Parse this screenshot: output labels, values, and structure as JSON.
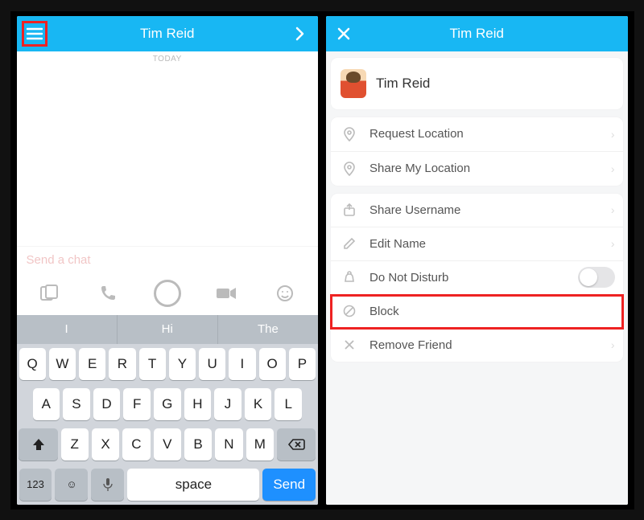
{
  "left": {
    "title": "Tim Reid",
    "meta": "TODAY",
    "placeholder": "Send a chat",
    "suggestions": [
      "I",
      "Hi",
      "The"
    ],
    "keys_r1": [
      "Q",
      "W",
      "E",
      "R",
      "T",
      "Y",
      "U",
      "I",
      "O",
      "P"
    ],
    "keys_r2": [
      "A",
      "S",
      "D",
      "F",
      "G",
      "H",
      "J",
      "K",
      "L"
    ],
    "keys_r3": [
      "Z",
      "X",
      "C",
      "V",
      "B",
      "N",
      "M"
    ],
    "key_123": "123",
    "key_space": "space",
    "key_send": "Send"
  },
  "right": {
    "title": "Tim Reid",
    "profile_name": "Tim Reid",
    "items": {
      "request_location": "Request Location",
      "share_my_location": "Share My Location",
      "share_username": "Share Username",
      "edit_name": "Edit Name",
      "do_not_disturb": "Do Not Disturb",
      "block": "Block",
      "remove_friend": "Remove Friend"
    }
  }
}
